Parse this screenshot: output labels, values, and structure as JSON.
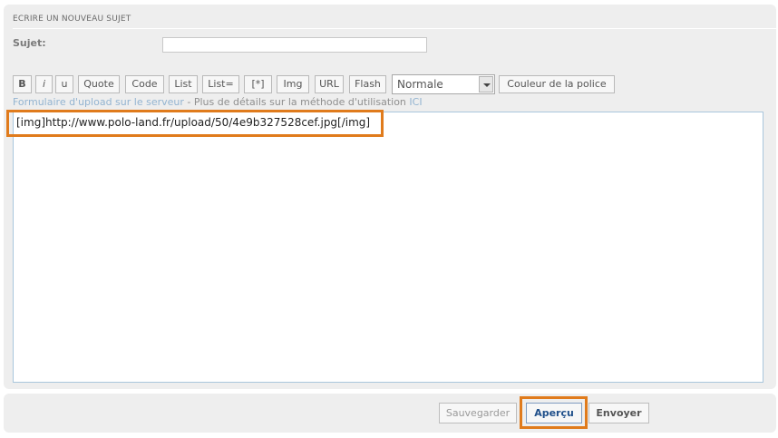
{
  "form": {
    "title": "ECRIRE UN NOUVEAU SUJET",
    "sujet_label": "Sujet:",
    "sujet_value": ""
  },
  "toolbar": {
    "bold": "B",
    "italic": "i",
    "underline": "u",
    "quote": "Quote",
    "code": "Code",
    "list": "List",
    "list_eq": "List=",
    "list_item": "[*]",
    "img": "Img",
    "url": "URL",
    "flash": "Flash",
    "size_selected": "Normale",
    "color": "Couleur de la police"
  },
  "upload": {
    "link_text": "Formulaire d'upload sur le serveur",
    "separator": " - ",
    "details_text": "Plus de détails sur la méthode d'utilisation",
    "ici": "ICI"
  },
  "editor": {
    "content": "[img]http://www.polo-land.fr/upload/50/4e9b327528cef.jpg[/img]"
  },
  "actions": {
    "save": "Sauvegarder",
    "preview": "Aperçu",
    "send": "Envoyer"
  },
  "colors": {
    "highlight": "#e07b1c",
    "link": "#93b4d1",
    "preview_text": "#1f4f8a"
  }
}
